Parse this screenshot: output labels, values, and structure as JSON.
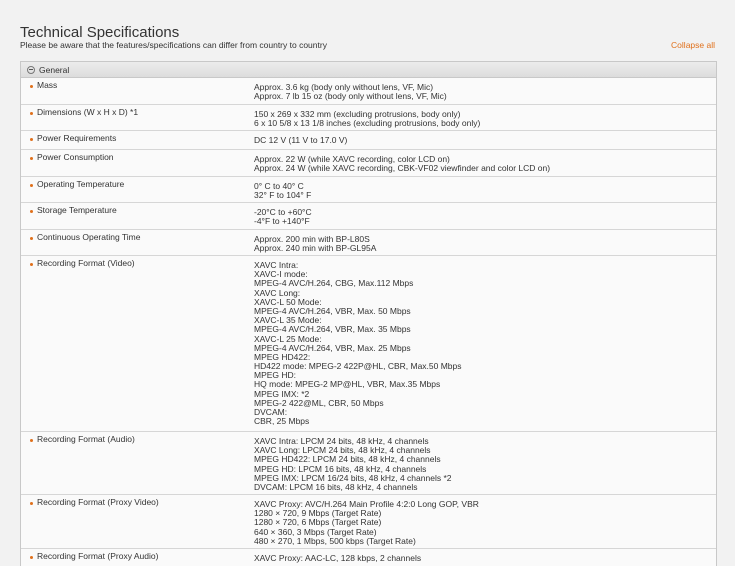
{
  "page": {
    "title": "Technical Specifications",
    "note": "Please be aware that the features/specifications can differ from country to country",
    "collapse_all": "Collapse all"
  },
  "section": {
    "title": "General",
    "toggle_icon": "collapse-minus-icon",
    "bullet_color": "#e0701b",
    "rows": [
      {
        "label": "Mass",
        "values": [
          "Approx. 3.6 kg (body only without lens, VF, Mic)",
          "Approx. 7 lb 15 oz (body only without lens, VF, Mic)"
        ]
      },
      {
        "label": "Dimensions (W x H x D) *1",
        "values": [
          "150 x 269 x 332 mm (excluding protrusions, body only)",
          "6 x 10 5/8 x 13 1/8 inches (excluding protrusions, body only)"
        ]
      },
      {
        "label": "Power Requirements",
        "values": [
          "DC 12 V (11 V to 17.0 V)"
        ]
      },
      {
        "label": "Power Consumption",
        "values": [
          "Approx. 22 W (while XAVC recording, color LCD on)",
          "Approx. 24 W (while XAVC recording, CBK-VF02 viewfinder and color LCD on)"
        ]
      },
      {
        "label": "Operating Temperature",
        "values": [
          "0° C to 40° C",
          "32° F to 104° F"
        ]
      },
      {
        "label": "Storage Temperature",
        "values": [
          "-20°C to +60°C",
          "-4°F to +140°F"
        ]
      },
      {
        "label": "Continuous Operating Time",
        "values": [
          "Approx. 200 min with BP-L80S",
          "Approx. 240 min with BP-GL95A"
        ]
      },
      {
        "label": "Recording Format (Video)",
        "values": [
          "XAVC Intra:",
          "XAVC-I mode:",
          "MPEG-4 AVC/H.264, CBG, Max.112 Mbps",
          "XAVC Long:",
          "XAVC-L 50 Mode:",
          "MPEG-4 AVC/H.264, VBR, Max. 50 Mbps",
          "XAVC-L 35 Mode:",
          "MPEG-4 AVC/H.264, VBR, Max. 35 Mbps",
          "XAVC-L 25 Mode:",
          "MPEG-4 AVC/H.264, VBR, Max. 25 Mbps",
          "MPEG HD422:",
          "HD422 mode: MPEG-2 422P@HL, CBR, Max.50 Mbps",
          "MPEG HD:",
          "HQ mode: MPEG-2 MP@HL, VBR, Max.35 Mbps",
          "MPEG IMX: *2",
          "MPEG-2 422@ML, CBR, 50 Mbps",
          "DVCAM:",
          "CBR, 25 Mbps"
        ]
      },
      {
        "label": "Recording Format (Audio)",
        "values": [
          "XAVC Intra: LPCM 24 bits, 48 kHz, 4 channels",
          "XAVC Long: LPCM 24 bits, 48 kHz, 4 channels",
          "MPEG HD422: LPCM 24 bits, 48 kHz, 4 channels",
          "MPEG HD: LPCM 16 bits, 48 kHz, 4 channels",
          "MPEG IMX: LPCM 16/24 bits, 48 kHz, 4 channels *2",
          "DVCAM: LPCM 16 bits, 48 kHz, 4 channels"
        ]
      },
      {
        "label": "Recording Format (Proxy Video)",
        "values": [
          "XAVC Proxy: AVC/H.264 Main Profile 4:2:0 Long GOP, VBR",
          "1280 × 720, 9 Mbps (Target Rate)",
          "1280 × 720, 6 Mbps (Target Rate)",
          "640 × 360, 3 Mbps (Target Rate)",
          "480 × 270, 1 Mbps, 500 kbps (Target Rate)"
        ]
      },
      {
        "label": "Recording Format (Proxy Audio)",
        "values": [
          "XAVC Proxy: AAC-LC, 128 kbps, 2 channels"
        ]
      }
    ]
  }
}
